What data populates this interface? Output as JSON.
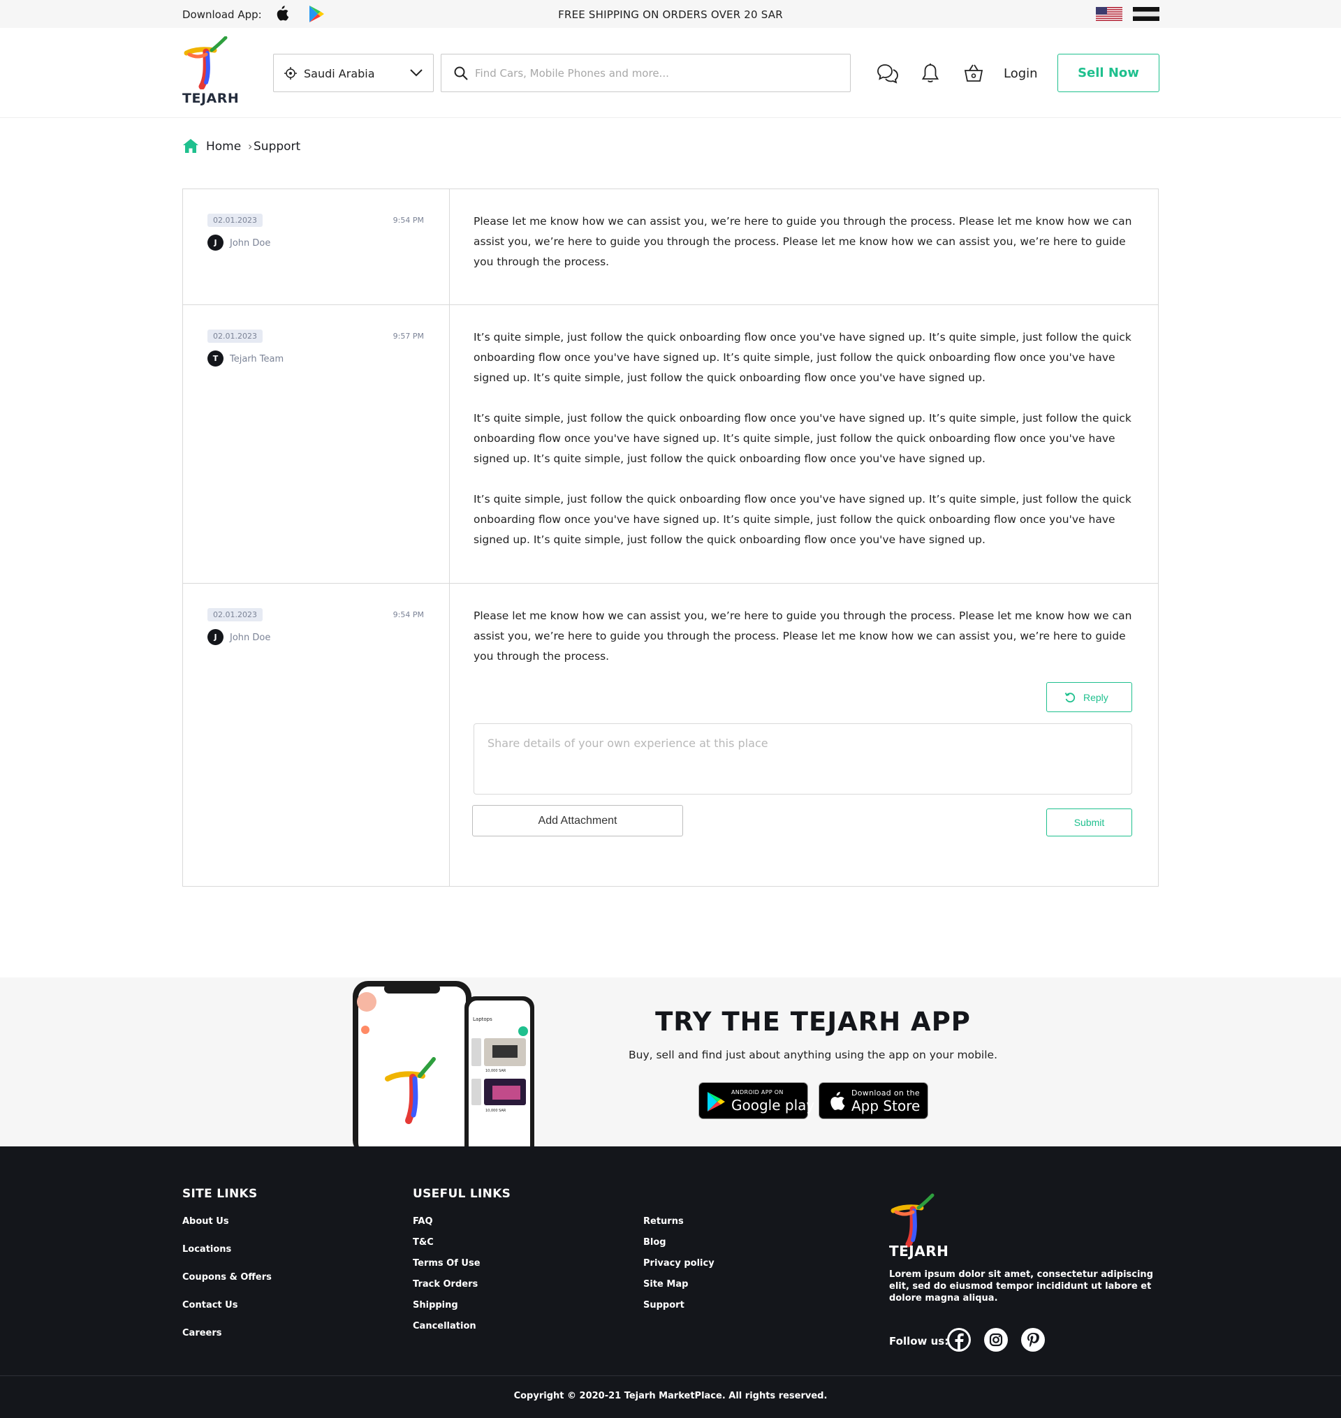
{
  "topbar": {
    "download_label": "Download App:",
    "shipping": "FREE SHIPPING ON ORDERS OVER 20 SAR"
  },
  "header": {
    "brand": "TEJARH",
    "country": "Saudi Arabia",
    "search_placeholder": "Find Cars, Mobile Phones and more...",
    "login": "Login",
    "sell": "Sell Now"
  },
  "breadcrumb": {
    "home": "Home",
    "separator": "›",
    "current": "Support"
  },
  "thread": [
    {
      "date": "02.01.2023",
      "time": "9:54 PM",
      "initial": "J",
      "author": "John Doe",
      "paragraphs": [
        "Please let me know how we can assist you, we’re here to guide you through the process. Please let me know how we can assist you, we’re here to guide you through the process. Please let me know how we can assist you, we’re here to guide you through the process."
      ]
    },
    {
      "date": "02.01.2023",
      "time": "9:57 PM",
      "initial": "T",
      "author": "Tejarh Team",
      "paragraphs": [
        "It’s quite simple, just follow the quick onboarding flow once you've have signed up. It’s quite simple, just follow the quick onboarding flow once you've have signed up. It’s quite simple, just follow the quick onboarding flow once you've have signed up. It’s quite simple, just follow the quick onboarding flow once you've have signed up.",
        "It’s quite simple, just follow the quick onboarding flow once you've have signed up. It’s quite simple, just follow the quick onboarding flow once you've have signed up. It’s quite simple, just follow the quick onboarding flow once you've have signed up. It’s quite simple, just follow the quick onboarding flow once you've have signed up.",
        "It’s quite simple, just follow the quick onboarding flow once you've have signed up. It’s quite simple, just follow the quick onboarding flow once you've have signed up. It’s quite simple, just follow the quick onboarding flow once you've have signed up. It’s quite simple, just follow the quick onboarding flow once you've have signed up."
      ]
    },
    {
      "date": "02.01.2023",
      "time": "9:54 PM",
      "initial": "J",
      "author": "John Doe",
      "paragraphs": [
        "Please let me know how we can assist you, we’re here to guide you through the process. Please let me know how we can assist you, we’re here to guide you through the process. Please let me know how we can assist you, we’re here to guide you through the process."
      ]
    }
  ],
  "reply_form": {
    "reply_label": "Reply",
    "placeholder": "Share details of your own experience at this place",
    "attachment_label": "Add Attachment",
    "submit_label": "Submit"
  },
  "app_promo": {
    "title": "TRY THE TEJARH APP",
    "subtitle": "Buy, sell and find just about anything using the app on your mobile.",
    "google_small": "ANDROID APP ON",
    "google_large": "Google play",
    "apple_small": "Download on the",
    "apple_large": "App Store",
    "phone_screen_label": "Laptops",
    "phone_price_1": "10,000 SAR",
    "phone_price_2": "10,000 SAR"
  },
  "footer": {
    "site_links_title": "SITE LINKS",
    "site_links": [
      "About Us",
      "Locations",
      "Coupons & Offers",
      "Contact Us",
      "Careers"
    ],
    "useful_links_title": "USEFUL LINKS",
    "useful_links": [
      "FAQ",
      "T&C",
      "Terms Of Use",
      "Track Orders",
      "Shipping",
      "Cancellation"
    ],
    "more_links": [
      "Returns",
      "Blog",
      "Privacy policy",
      "Site Map",
      "Support"
    ],
    "brand": "TEJARH",
    "description": "Lorem ipsum dolor sit amet, consectetur adipiscing elit, sed do eiusmod tempor incididunt ut labore et dolore magna aliqua.",
    "follow_label": "Follow us:",
    "copyright": "Copyright © 2020-21 Tejarh MarketPlace. All rights reserved."
  },
  "colors": {
    "accent": "#1fc08e",
    "dark": "#14161b",
    "muted": "#7b8396",
    "border": "#d9d9d9"
  }
}
